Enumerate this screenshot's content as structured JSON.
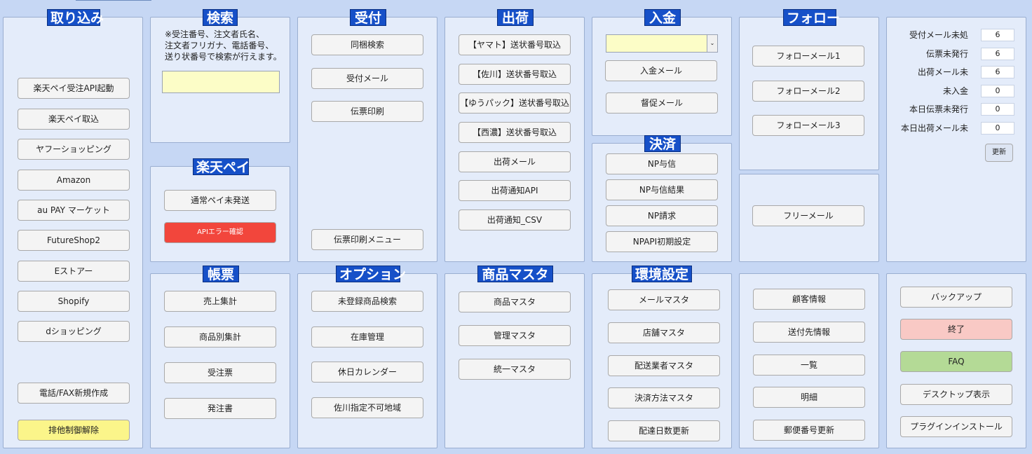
{
  "panels": {
    "torikomi": {
      "title": "取り込み",
      "buttons": [
        "楽天ペイ受注API起動",
        "楽天ペイ取込",
        "ヤフーショッピング",
        "Amazon",
        "au PAY マーケット",
        "FutureShop2",
        "Eストアー",
        "Shopify",
        "dショッピング",
        "電話/FAX新規作成",
        "排他制御解除"
      ]
    },
    "search": {
      "title": "検索",
      "note": "※受注番号、注文者氏名、\n注文者フリガナ、電話番号、\n送り状番号で検索が行えます。",
      "input_value": ""
    },
    "rakuten": {
      "title": "楽天ペイ",
      "buttons": [
        "通常ペイ未発送",
        "APIエラー確認"
      ]
    },
    "uketsuke": {
      "title": "受付",
      "buttons": [
        "同梱検索",
        "受付メール",
        "伝票印刷",
        "伝票印刷メニュー"
      ]
    },
    "shukka": {
      "title": "出荷",
      "buttons": [
        "【ヤマト】送状番号取込",
        "【佐川】送状番号取込",
        "【ゆうパック】送状番号取込",
        "【西濃】送状番号取込",
        "出荷メール",
        "出荷通知API",
        "出荷通知_CSV"
      ]
    },
    "nyukin": {
      "title": "入金",
      "select_value": "",
      "buttons": [
        "入金メール",
        "督促メール"
      ]
    },
    "kessai": {
      "title": "決済",
      "buttons": [
        "NP与信",
        "NP与信結果",
        "NP請求",
        "NPAPI初期設定"
      ]
    },
    "follow": {
      "title": "フォロー",
      "buttons": [
        "フォローメール1",
        "フォローメール2",
        "フォローメール3"
      ]
    },
    "free": {
      "buttons": [
        "フリーメール"
      ]
    },
    "stats": {
      "items": [
        {
          "label": "受付メール未処",
          "value": "6"
        },
        {
          "label": "伝票未発行",
          "value": "6"
        },
        {
          "label": "出荷メール未",
          "value": "6"
        },
        {
          "label": "未入金",
          "value": "0"
        },
        {
          "label": "本日伝票未発行",
          "value": "0"
        },
        {
          "label": "本日出荷メール未",
          "value": "0"
        }
      ],
      "refresh_label": "更新"
    },
    "chohyo": {
      "title": "帳票",
      "buttons": [
        "売上集計",
        "商品別集計",
        "受注票",
        "発注書"
      ]
    },
    "option": {
      "title": "オプション",
      "buttons": [
        "未登録商品検索",
        "在庫管理",
        "休日カレンダー",
        "佐川指定不可地域"
      ]
    },
    "shohin": {
      "title": "商品マスタ",
      "buttons": [
        "商品マスタ",
        "管理マスタ",
        "統一マスタ"
      ]
    },
    "kankyo": {
      "title": "環境設定",
      "buttons": [
        "メールマスタ",
        "店舗マスタ",
        "配送業者マスタ",
        "決済方法マスタ",
        "配達日数更新"
      ]
    },
    "kokyaku": {
      "buttons": [
        "顧客情報",
        "送付先情報",
        "一覧",
        "明細",
        "郵便番号更新"
      ]
    },
    "system": {
      "buttons": [
        "バックアップ",
        "終了",
        "FAQ",
        "デスクトップ表示",
        "プラグインインストール"
      ]
    }
  },
  "colors": {
    "background": "#c6d7f4",
    "panel": "#e4ecfa",
    "title_bar": "#1650c8",
    "input_yellow": "#fcfdc7",
    "error_red": "#f2463c",
    "unlock_yellow": "#fbf58a",
    "exit_pink": "#f9c9c5",
    "faq_green": "#b4da96"
  }
}
